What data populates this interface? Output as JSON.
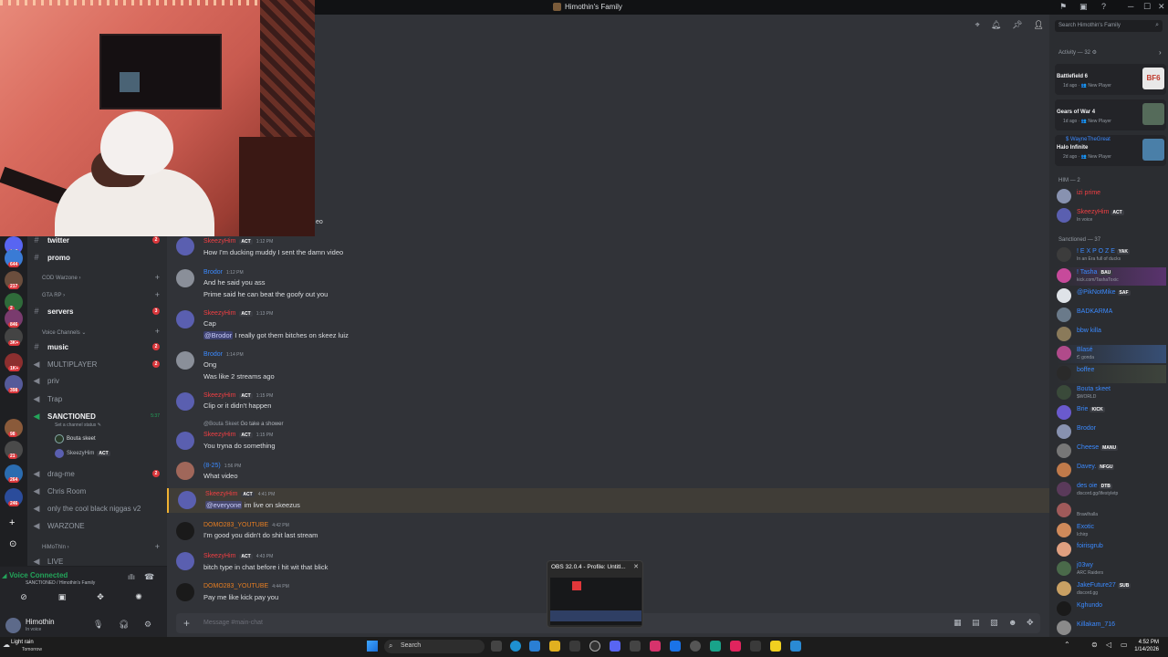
{
  "window": {
    "title": "Himothin's Family",
    "controls": [
      "─",
      "☐",
      "✕"
    ]
  },
  "channels": {
    "rows": [
      {
        "symbol": "#",
        "label": "twitter",
        "unread": true,
        "badge": "2"
      },
      {
        "symbol": "#",
        "label": "promo",
        "unread": true,
        "badge": ""
      },
      {
        "symbol": "#",
        "label": "servers",
        "unread": true,
        "badge": "3"
      },
      {
        "symbol": "#",
        "label": "music",
        "unread": true,
        "badge": "2"
      },
      {
        "symbol": "🔊",
        "label": "MULTIPLAYER",
        "unread": false,
        "badge": "2"
      },
      {
        "symbol": "🔊",
        "label": "priv",
        "unread": false,
        "badge": ""
      },
      {
        "symbol": "🔊",
        "label": "Trap",
        "unread": false,
        "badge": ""
      },
      {
        "symbol": "🔊",
        "label": "SANCTIONED",
        "unread": true,
        "badge": ""
      },
      {
        "symbol": "🔊",
        "label": "drag-me",
        "unread": false,
        "badge": "2"
      },
      {
        "symbol": "🔊",
        "label": "Chris Room",
        "unread": false,
        "badge": ""
      },
      {
        "symbol": "🔊",
        "label": "only the cool black niggas v2",
        "unread": false,
        "badge": ""
      },
      {
        "symbol": "🔊",
        "label": "WARZONE",
        "unread": false,
        "badge": ""
      },
      {
        "symbol": "🔊",
        "label": "LIVE",
        "unread": false,
        "badge": ""
      }
    ],
    "categories": [
      "COD Warzone ›",
      "GTA RP ›",
      "Voice Channels ⌄",
      "HiMoThIn ›"
    ],
    "sanctioned_timer": "5:37",
    "sanctioned_status": "Set a channel status ✎",
    "voice_users": [
      {
        "name": "Bouta skeet",
        "tag": ""
      },
      {
        "name": "SkeezyHim",
        "tag": "ACT"
      }
    ]
  },
  "server_badges": [
    "167",
    "644",
    "217",
    "2",
    "846",
    "3K+",
    "1K+",
    "398",
    "98",
    "21",
    "264",
    "246"
  ],
  "voice_panel": {
    "title": "Voice Connected",
    "subtitle": "SANCTIONED / Himothin's Family"
  },
  "user_panel": {
    "name": "Himothin",
    "status": "In voice"
  },
  "chat": {
    "partial_text": "eo",
    "messages": [
      {
        "author": "SkeezyHim",
        "color": "#f23f43",
        "tag": "ACT",
        "time": "1:12 PM",
        "lines": [
          "How I'm ducking muddy I sent the damn video"
        ]
      },
      {
        "author": "Brodor",
        "color": "#3b8aff",
        "tag": "",
        "time": "1:12 PM",
        "lines": [
          "And he said you ass",
          "Prime said he can beat the goofy out you"
        ]
      },
      {
        "author": "SkeezyHim",
        "color": "#f23f43",
        "tag": "ACT",
        "time": "1:13 PM",
        "lines": [
          "Cap",
          "@Brodor I really got them bitches on skeez luiz"
        ]
      },
      {
        "author": "Brodor",
        "color": "#3b8aff",
        "tag": "",
        "time": "1:14 PM",
        "lines": [
          "Ong",
          "Was like 2 streams ago"
        ]
      },
      {
        "author": "SkeezyHim",
        "color": "#f23f43",
        "tag": "ACT",
        "time": "1:15 PM",
        "lines": [
          "Clip or it didn't happen"
        ]
      },
      {
        "author": "SkeezyHim",
        "color": "#f23f43",
        "tag": "ACT",
        "time": "1:15 PM",
        "reply": {
          "name": "@Bouta Skeet",
          "text": "Go take a shower"
        },
        "lines": [
          "You tryna do something"
        ]
      },
      {
        "author": "(8-25)",
        "color": "#3b8aff",
        "tag": "",
        "time": "1:56 PM",
        "lines": [
          "What video"
        ]
      },
      {
        "author": "SkeezyHim",
        "color": "#f23f43",
        "tag": "ACT",
        "time": "4:41 PM",
        "lines": [
          "@everyone im live on skeezus"
        ]
      },
      {
        "author": "DOMO283_YOUTUBE",
        "color": "#e67e22",
        "tag": "",
        "time": "4:42 PM",
        "lines": [
          "I'm good you didn't do shit last stream"
        ]
      },
      {
        "author": "SkeezyHim",
        "color": "#f23f43",
        "tag": "ACT",
        "time": "4:43 PM",
        "lines": [
          "bitch type in chat before i hit wit that blick"
        ]
      },
      {
        "author": "DOMO283_YOUTUBE",
        "color": "#e67e22",
        "tag": "",
        "time": "4:44 PM",
        "lines": [
          "Pay me like kick pay you"
        ]
      }
    ],
    "mention_brodor": "@Brodor",
    "mention_everyone": "@everyone"
  },
  "composer": {
    "placeholder": "Message #main-chat"
  },
  "members": {
    "search_placeholder": "Search Himothin's Family",
    "activity_header": "Activity — 32 ⚙",
    "activities": [
      {
        "user": "",
        "game": "Battlefield 6",
        "meta": "1d ago · 👥 New Player",
        "color": "#c0392b"
      },
      {
        "user": "",
        "game": "Gears of War 4",
        "meta": "1d ago · 👥 New Player",
        "color": "#556b5a"
      },
      {
        "user": "$ WayneTheGreat",
        "game": "Halo Infinite",
        "meta": "2d ago · 👥 New Player",
        "color": "#4a7fa8"
      }
    ],
    "groups": [
      {
        "label": "HIM — 2",
        "members": [
          {
            "name": "izi prime",
            "color": "#f23f43",
            "tag": "",
            "status": ""
          },
          {
            "name": "SkeezyHim",
            "color": "#f23f43",
            "tag": "ACT",
            "status": "In voice"
          }
        ]
      },
      {
        "label": "Sanctioned — 37",
        "members": [
          {
            "name": "! E X P O Z E",
            "color": "#3b8aff",
            "tag": "YAK",
            "status": "In an Era full of ducks"
          },
          {
            "name": "! Tasha",
            "color": "#3b8aff",
            "tag": "BAU",
            "status": "kick.com/TashaToxic"
          },
          {
            "name": "@PikNotMike",
            "color": "#3b8aff",
            "tag": "SAF",
            "status": ""
          },
          {
            "name": "BADKARMA",
            "color": "#3b8aff",
            "tag": "",
            "status": ""
          },
          {
            "name": "bbw killa",
            "color": "#3b8aff",
            "tag": "",
            "status": ""
          },
          {
            "name": "Blasé",
            "color": "#3b8aff",
            "tag": "",
            "status": "ඞ gonda"
          },
          {
            "name": "boffee",
            "color": "#3b8aff",
            "tag": "",
            "status": ""
          },
          {
            "name": "Bouta skeet",
            "color": "#3b8aff",
            "tag": "",
            "status": "$WORLD"
          },
          {
            "name": "Brie",
            "color": "#3b8aff",
            "tag": "KICK",
            "status": ""
          },
          {
            "name": "Brodor",
            "color": "#3b8aff",
            "tag": "",
            "status": ""
          },
          {
            "name": "Cheese",
            "color": "#3b8aff",
            "tag": "MANU",
            "status": ""
          },
          {
            "name": "Davey.",
            "color": "#3b8aff",
            "tag": "NFGU",
            "status": ""
          },
          {
            "name": "des oie",
            "color": "#3b8aff",
            "tag": "DTB",
            "status": "discord.gg/lifestyletp"
          },
          {
            "name": "",
            "color": "#3b8aff",
            "tag": "",
            "status": "Brawlhalla"
          },
          {
            "name": "Exotic",
            "color": "#3b8aff",
            "tag": "",
            "status": "Ichirp"
          },
          {
            "name": "foirisgrub",
            "color": "#3b8aff",
            "tag": "",
            "status": ""
          },
          {
            "name": "j03wy",
            "color": "#3b8aff",
            "tag": "",
            "status": "ARC Raiders"
          },
          {
            "name": "JakeFuture27",
            "color": "#3b8aff",
            "tag": "SUB",
            "status": "discord.gg"
          },
          {
            "name": "Kghundo",
            "color": "#3b8aff",
            "tag": "",
            "status": ""
          },
          {
            "name": "Killakam_716",
            "color": "#3b8aff",
            "tag": "",
            "status": ""
          }
        ]
      }
    ]
  },
  "obs_preview": {
    "title": "OBS 32.0.4 - Profile: Untitl..."
  },
  "taskbar": {
    "weather": "Light rain",
    "weather_sub": "Tomorrow",
    "search_label": "Search",
    "time": "4:52 PM",
    "date": "1/14/2026"
  }
}
